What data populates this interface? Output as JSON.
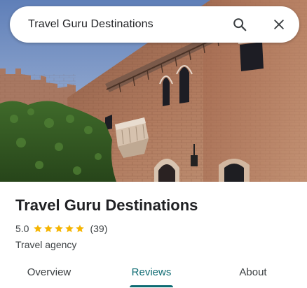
{
  "search": {
    "query": "Travel Guru Destinations",
    "search_icon": "search-icon",
    "clear_icon": "close-icon"
  },
  "place": {
    "name": "Travel Guru Destinations",
    "rating": "5.0",
    "stars": 5,
    "review_count": "(39)",
    "category": "Travel agency"
  },
  "tabs": [
    {
      "label": "Overview",
      "active": false
    },
    {
      "label": "Reviews",
      "active": true
    },
    {
      "label": "About",
      "active": false
    }
  ],
  "colors": {
    "accent": "#0e6b73",
    "star": "#f5b400",
    "text_primary": "#202124",
    "text_secondary": "#3c4043"
  }
}
